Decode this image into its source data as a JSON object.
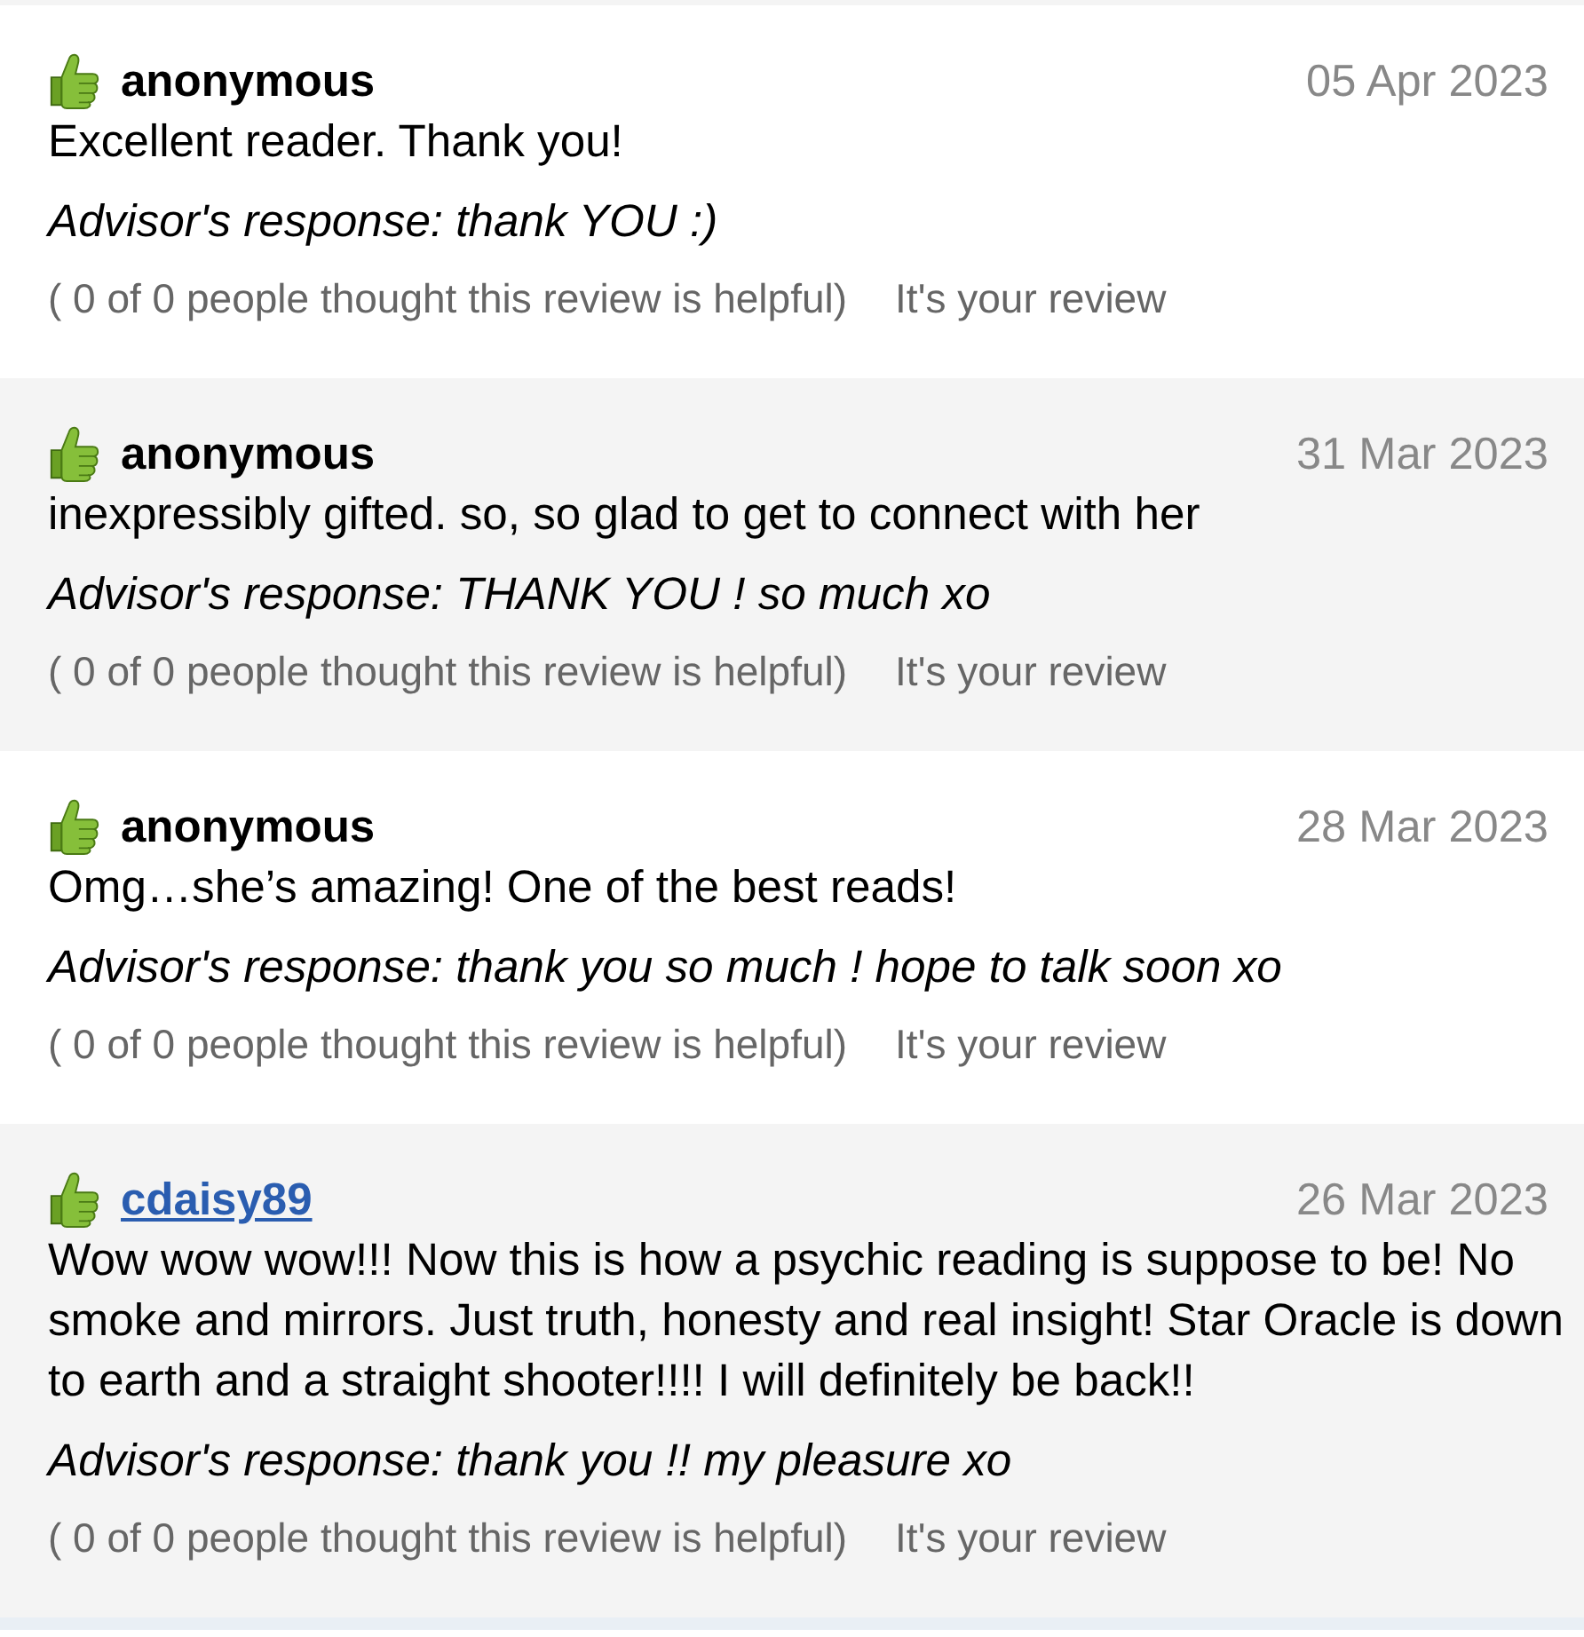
{
  "reviews": [
    {
      "author": "anonymous",
      "author_linked": false,
      "date": "05 Apr 2023",
      "text": "Excellent reader. Thank you!",
      "response": "Advisor's response: thank YOU :)",
      "helpful": "( 0 of 0 people thought this review is helpful)",
      "ownership": "It's your review"
    },
    {
      "author": "anonymous",
      "author_linked": false,
      "date": "31 Mar 2023",
      "text": "inexpressibly gifted. so, so glad to get to connect with her",
      "response": "Advisor's response: THANK YOU ! so much xo",
      "helpful": "( 0 of 0 people thought this review is helpful)",
      "ownership": "It's your review"
    },
    {
      "author": "anonymous",
      "author_linked": false,
      "date": "28 Mar 2023",
      "text": "Omg…she’s amazing! One of the best reads!",
      "response": "Advisor's response: thank you so much ! hope to talk soon xo",
      "helpful": "( 0 of 0 people thought this review is helpful)",
      "ownership": "It's your review"
    },
    {
      "author": "cdaisy89",
      "author_linked": true,
      "date": "26 Mar 2023",
      "text": "Wow wow wow!!! Now this is how a psychic reading is suppose to be! No smoke and mirrors. Just truth, honesty and real insight! Star Oracle is down to earth and a straight shooter!!!! I will definitely be back!!",
      "response": "Advisor's response: thank you !! my pleasure xo",
      "helpful": "( 0 of 0 people thought this review is helpful)",
      "ownership": "It's your review"
    }
  ]
}
